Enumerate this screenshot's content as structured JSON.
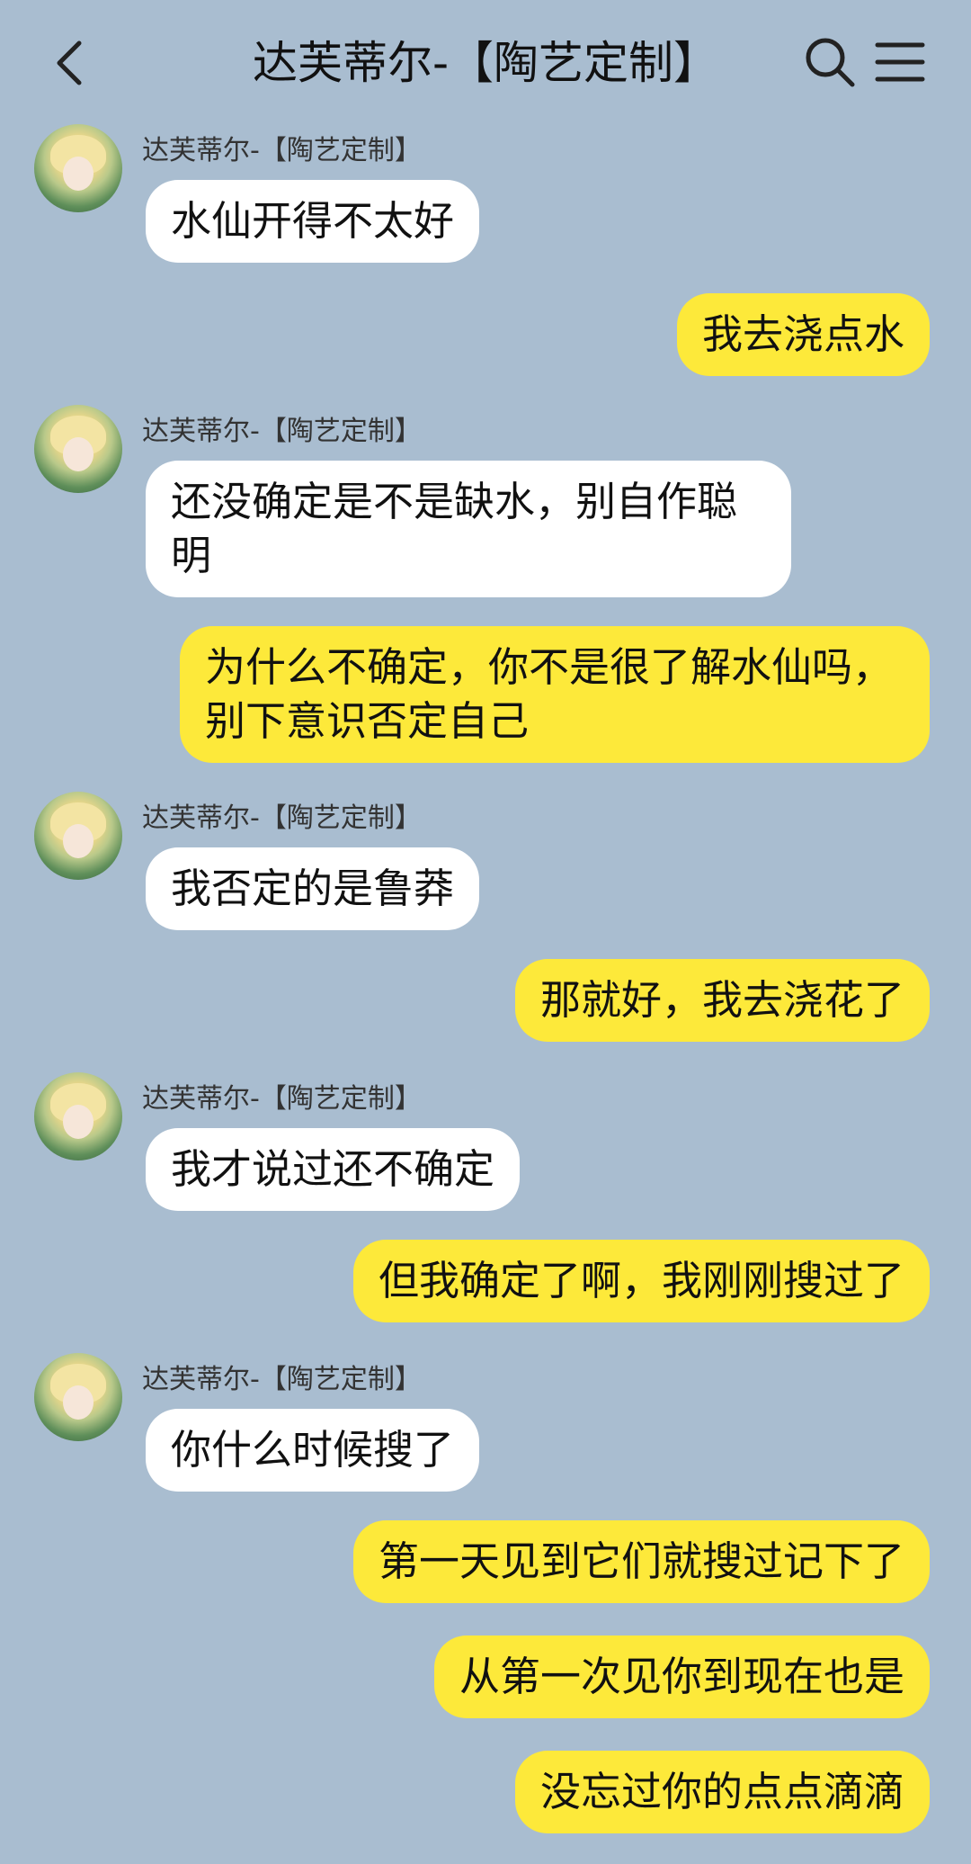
{
  "header": {
    "title": "达芙蒂尔-【陶艺定制】"
  },
  "messages": [
    {
      "side": "in",
      "sender": "达芙蒂尔-【陶艺定制】",
      "text": "水仙开得不太好"
    },
    {
      "side": "out",
      "text": "我去浇点水"
    },
    {
      "side": "in",
      "sender": "达芙蒂尔-【陶艺定制】",
      "text": "还没确定是不是缺水，别自作聪明"
    },
    {
      "side": "out",
      "text": "为什么不确定，你不是很了解水仙吗，别下意识否定自己"
    },
    {
      "side": "in",
      "sender": "达芙蒂尔-【陶艺定制】",
      "text": "我否定的是鲁莽"
    },
    {
      "side": "out",
      "text": "那就好，我去浇花了"
    },
    {
      "side": "in",
      "sender": "达芙蒂尔-【陶艺定制】",
      "text": "我才说过还不确定"
    },
    {
      "side": "out",
      "text": "但我确定了啊，我刚刚搜过了"
    },
    {
      "side": "in",
      "sender": "达芙蒂尔-【陶艺定制】",
      "text": "你什么时候搜了"
    },
    {
      "side": "out",
      "text": "第一天见到它们就搜过记下了"
    },
    {
      "side": "out",
      "text": "从第一次见你到现在也是"
    },
    {
      "side": "out",
      "text": "没忘过你的点点滴滴"
    }
  ],
  "colors": {
    "background": "#a9bdd0",
    "incoming": "#ffffff",
    "outgoing": "#fde93a"
  },
  "icons": {
    "back": "chevron-left-icon",
    "search": "search-icon",
    "menu": "menu-icon"
  }
}
